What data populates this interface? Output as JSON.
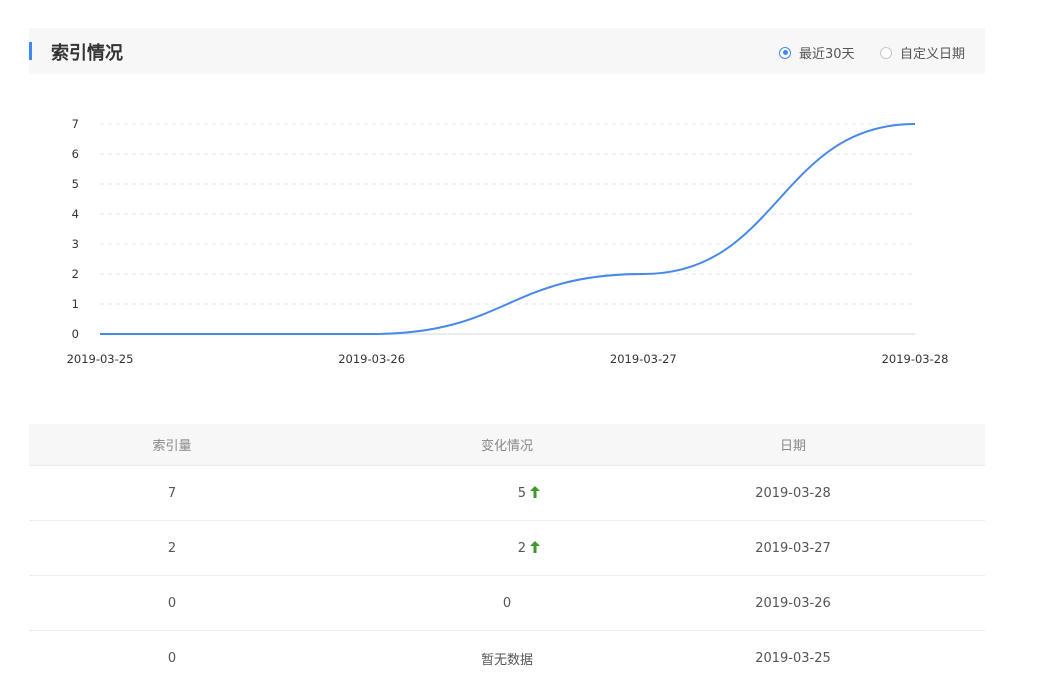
{
  "header": {
    "title": "索引情况",
    "range_options": [
      {
        "label": "最近30天",
        "checked": true
      },
      {
        "label": "自定义日期",
        "checked": false
      }
    ]
  },
  "colors": {
    "accent": "#3f87f5",
    "line": "#4689e8",
    "up_arrow": "#3a9a2a"
  },
  "chart_data": {
    "type": "line",
    "title": "",
    "xlabel": "",
    "ylabel": "",
    "x": [
      "2019-03-25",
      "2019-03-26",
      "2019-03-27",
      "2019-03-28"
    ],
    "series": [
      {
        "values": [
          0,
          0,
          2,
          7
        ]
      }
    ],
    "ylim": [
      0,
      7
    ],
    "yticks": [
      0,
      1,
      2,
      3,
      4,
      5,
      6,
      7
    ],
    "grid": "horizontal-dashed",
    "smooth": true
  },
  "table": {
    "headers": [
      "索引量",
      "变化情况",
      "日期"
    ],
    "rows": [
      {
        "count": "7",
        "change": "5",
        "up": true,
        "date": "2019-03-28"
      },
      {
        "count": "2",
        "change": "2",
        "up": true,
        "date": "2019-03-27"
      },
      {
        "count": "0",
        "change": "0",
        "up": false,
        "date": "2019-03-26"
      },
      {
        "count": "0",
        "change": "暂无数据",
        "up": false,
        "date": "2019-03-25"
      }
    ]
  }
}
